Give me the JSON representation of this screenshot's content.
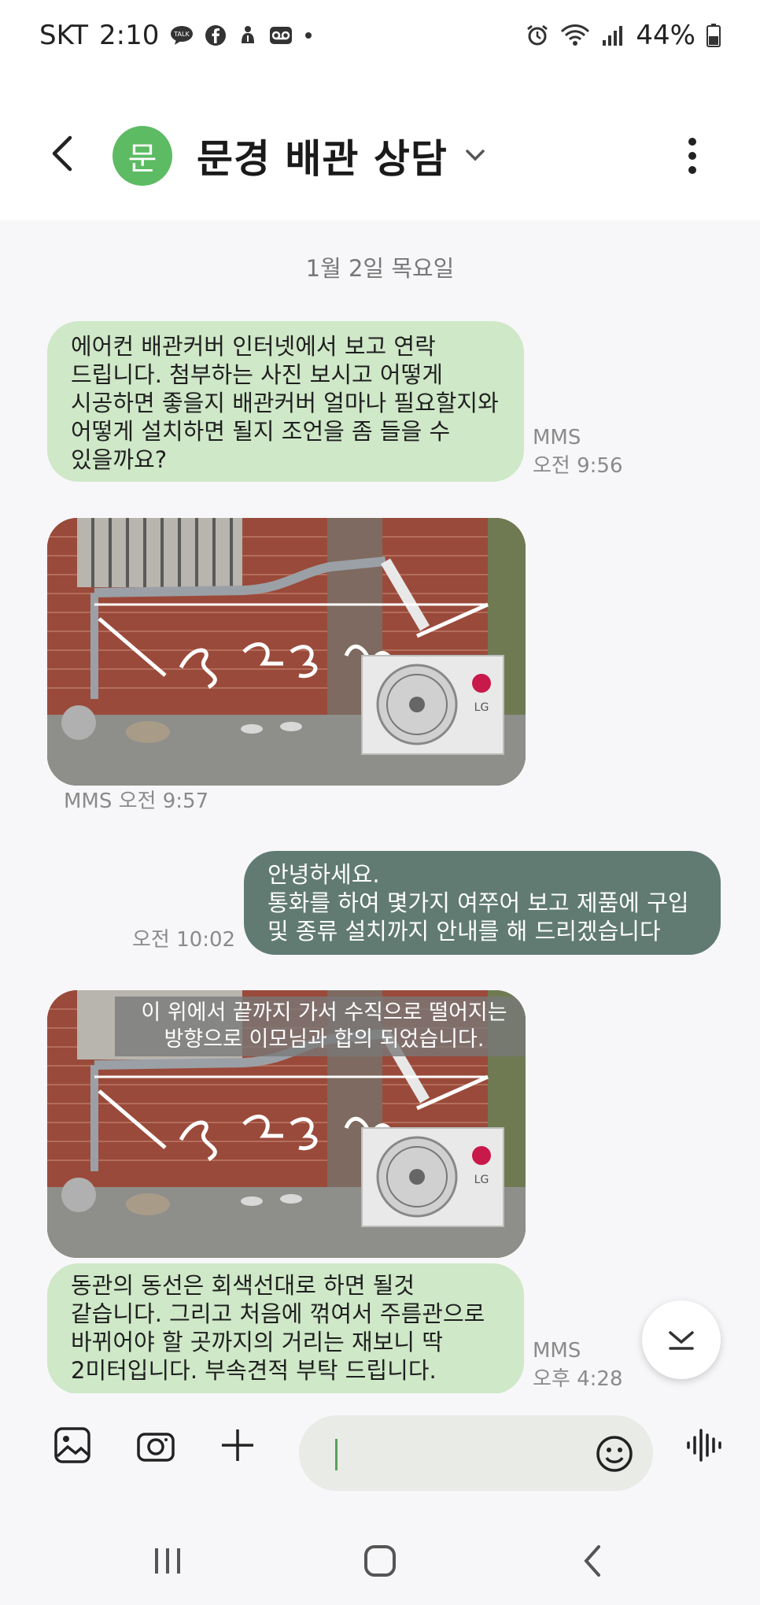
{
  "status_bar": {
    "carrier": "SKT",
    "time": "2:10",
    "icons_left": [
      "talk-icon",
      "facebook-icon",
      "gesture-icon",
      "voicemail-icon",
      "dot-icon"
    ],
    "icons_right": [
      "alarm-icon",
      "wifi-icon",
      "signal-icon"
    ],
    "battery": "44%"
  },
  "header": {
    "avatar_letter": "문",
    "avatar_color": "#5dbb63",
    "contact_name": "문경 배관 상담"
  },
  "conversation": {
    "date_separator": "1월 2일 목요일",
    "messages": [
      {
        "direction": "incoming",
        "type": "text",
        "lines": [
          "에어컨 배관커버 인터넷에서 보고 연락",
          "드립니다. 첨부하는 사진 보시고 어떻게",
          "시공하면 좋을지 배관커버 얼마나 필요할지와",
          "어떻게 설치하면 될지 조언을 좀 들을 수",
          "있을까요?"
        ],
        "meta_type": "MMS",
        "meta_time": "오전 9:56"
      },
      {
        "direction": "incoming",
        "type": "image",
        "meta": "MMS 오전 9:57"
      },
      {
        "direction": "outgoing",
        "type": "text",
        "lines": [
          "안녕하세요.",
          "통화를 하여 몇가지 여쭈어 보고 제품에 구입",
          "및 종류 설치까지 안내를 해 드리겠습니다"
        ],
        "meta_time": "오전 10:02"
      },
      {
        "direction": "incoming",
        "type": "image",
        "caption_lines": [
          "이 위에서 끝까지 가서 수직으로 떨어지는",
          "방향으로 이모님과 합의 되었습니다."
        ]
      },
      {
        "direction": "incoming",
        "type": "text",
        "lines": [
          "동관의 동선은 회색선대로 하면 될것",
          "같습니다. 그리고 처음에 꺾여서 주름관으로",
          "바뀌어야 할 곳까지의 거리는 재보니 딱",
          "2미터입니다. 부속견적 부탁 드립니다."
        ],
        "meta_type": "MMS",
        "meta_time": "오후 4:28"
      }
    ]
  },
  "colors": {
    "incoming_bubble": "#cfe8c8",
    "outgoing_bubble": "#617b72",
    "background": "#f7f7f9"
  }
}
